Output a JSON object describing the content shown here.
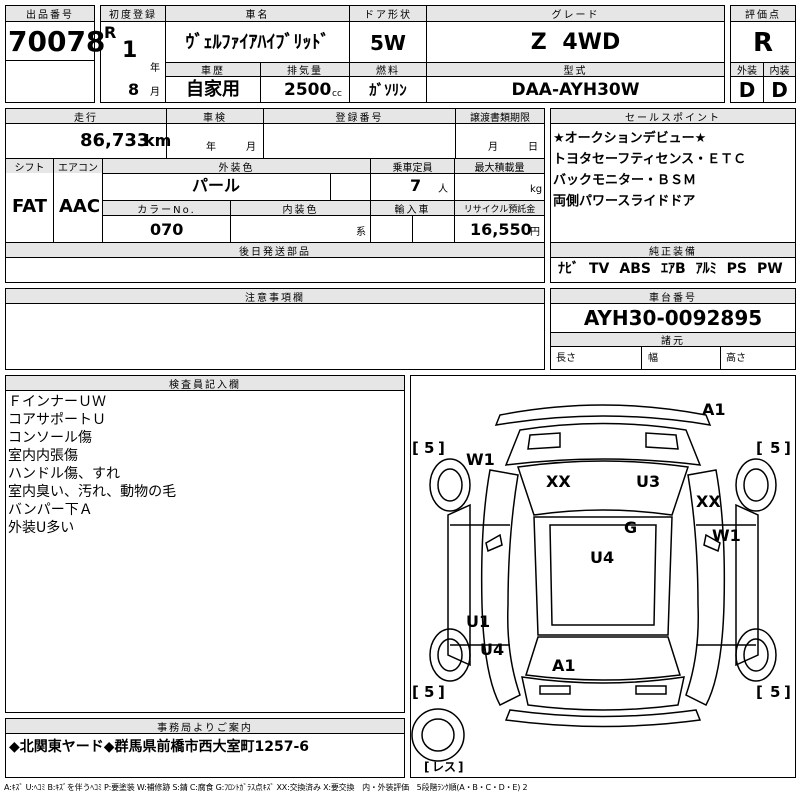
{
  "header": {
    "lot_label": "出品番号",
    "lot_number": "70078",
    "first_reg_label": "初度登録",
    "era": "R",
    "year": "1",
    "year_unit": "年",
    "month": "8",
    "month_unit": "月",
    "car_name_label": "車名",
    "car_name": "ｳﾞｪﾙﾌｧｲｱﾊｲﾌﾞﾘｯﾄﾞ",
    "history_label": "車歴",
    "history": "自家用",
    "displacement_label": "排気量",
    "displacement": "2500",
    "displacement_unit": "cc",
    "door_label": "ドア形状",
    "door": "5W",
    "fuel_label": "燃料",
    "fuel": "ｶﾞｿﾘﾝ",
    "grade_label": "グレード",
    "grade": "Z 4WD",
    "model_label": "型式",
    "model": "DAA-AYH30W",
    "score_label": "評価点",
    "score": "R",
    "exterior_label": "外装",
    "exterior": "D",
    "interior_label": "内装",
    "interior": "D"
  },
  "info": {
    "mileage_label": "走行",
    "mileage": "86,733",
    "mileage_unit": "km",
    "inspection_label": "車検",
    "year_unit": "年",
    "month_unit": "月",
    "plate_label": "登録番号",
    "transfer_label": "譲渡書類期限",
    "day_unit": "日",
    "shift_label": "シフト",
    "shift": "FAT",
    "ac_label": "エアコン",
    "ac": "AAC",
    "color_label": "外装色",
    "color": "パール",
    "seats_label": "乗車定員",
    "seats": "7",
    "seats_unit": "人",
    "load_label": "最大積載量",
    "load_unit": "kg",
    "color_no_label": "カラーNo.",
    "color_no": "070",
    "int_color_label": "内装色",
    "int_color_unit": "系",
    "import_label": "輸入車",
    "recycle_label": "リサイクル預託金",
    "recycle": "16,550",
    "recycle_unit": "円",
    "later_parts_label": "後日発送部品",
    "caution_label": "注意事項欄"
  },
  "sales_points": {
    "label": "セールスポイント",
    "items": [
      "★オークションデビュー★",
      "トヨタセーフティセンス・ＥＴＣ",
      "バックモニター・ＢＳＭ",
      "両側パワースライドドア"
    ]
  },
  "equipment": {
    "label": "純正装備",
    "items": [
      "ﾅﾋﾞ",
      "TV",
      "ABS",
      "ｴｱB",
      "ｱﾙﾐ",
      "PS",
      "PW"
    ]
  },
  "chassis": {
    "label": "車台番号",
    "number": "AYH30-0092895"
  },
  "dimensions": {
    "label": "諸元",
    "length_label": "長さ",
    "width_label": "幅",
    "height_label": "高さ"
  },
  "inspector": {
    "label": "検査員記入欄",
    "notes": [
      "ＦインナーＵＷ",
      "コアサポートＵ",
      "コンソール傷",
      "室内内張傷",
      "ハンドル傷、すれ",
      "室内臭い、汚れ、動物の毛",
      "バンパー下Ａ",
      "外装U多い"
    ]
  },
  "diagram": {
    "tire_fl": "5",
    "tire_fr": "5",
    "tire_rl": "5",
    "tire_rr": "5",
    "spare": "レス",
    "marks": [
      "A1",
      "W1",
      "XX",
      "U3",
      "XX",
      "G",
      "W1",
      "U4",
      "U1",
      "U4",
      "A1"
    ]
  },
  "office": {
    "label": "事務局よりご案内",
    "message": "◆北関東ヤード◆群馬県前橋市西大室町1257-6"
  },
  "legend": "A:ｷｽﾞ U:ﾍｺﾐ B:ｷｽﾞを伴うﾍｺﾐ P:要塗装 W:補修跡 S:錆 C:腐食 G:ﾌﾛﾝﾄｶﾞﾗｽ点ｷｽﾞ XX:交換済み X:要交換　内・外装評価　5段階ﾗﾝｸ順(A・B・C・D・E) 2"
}
